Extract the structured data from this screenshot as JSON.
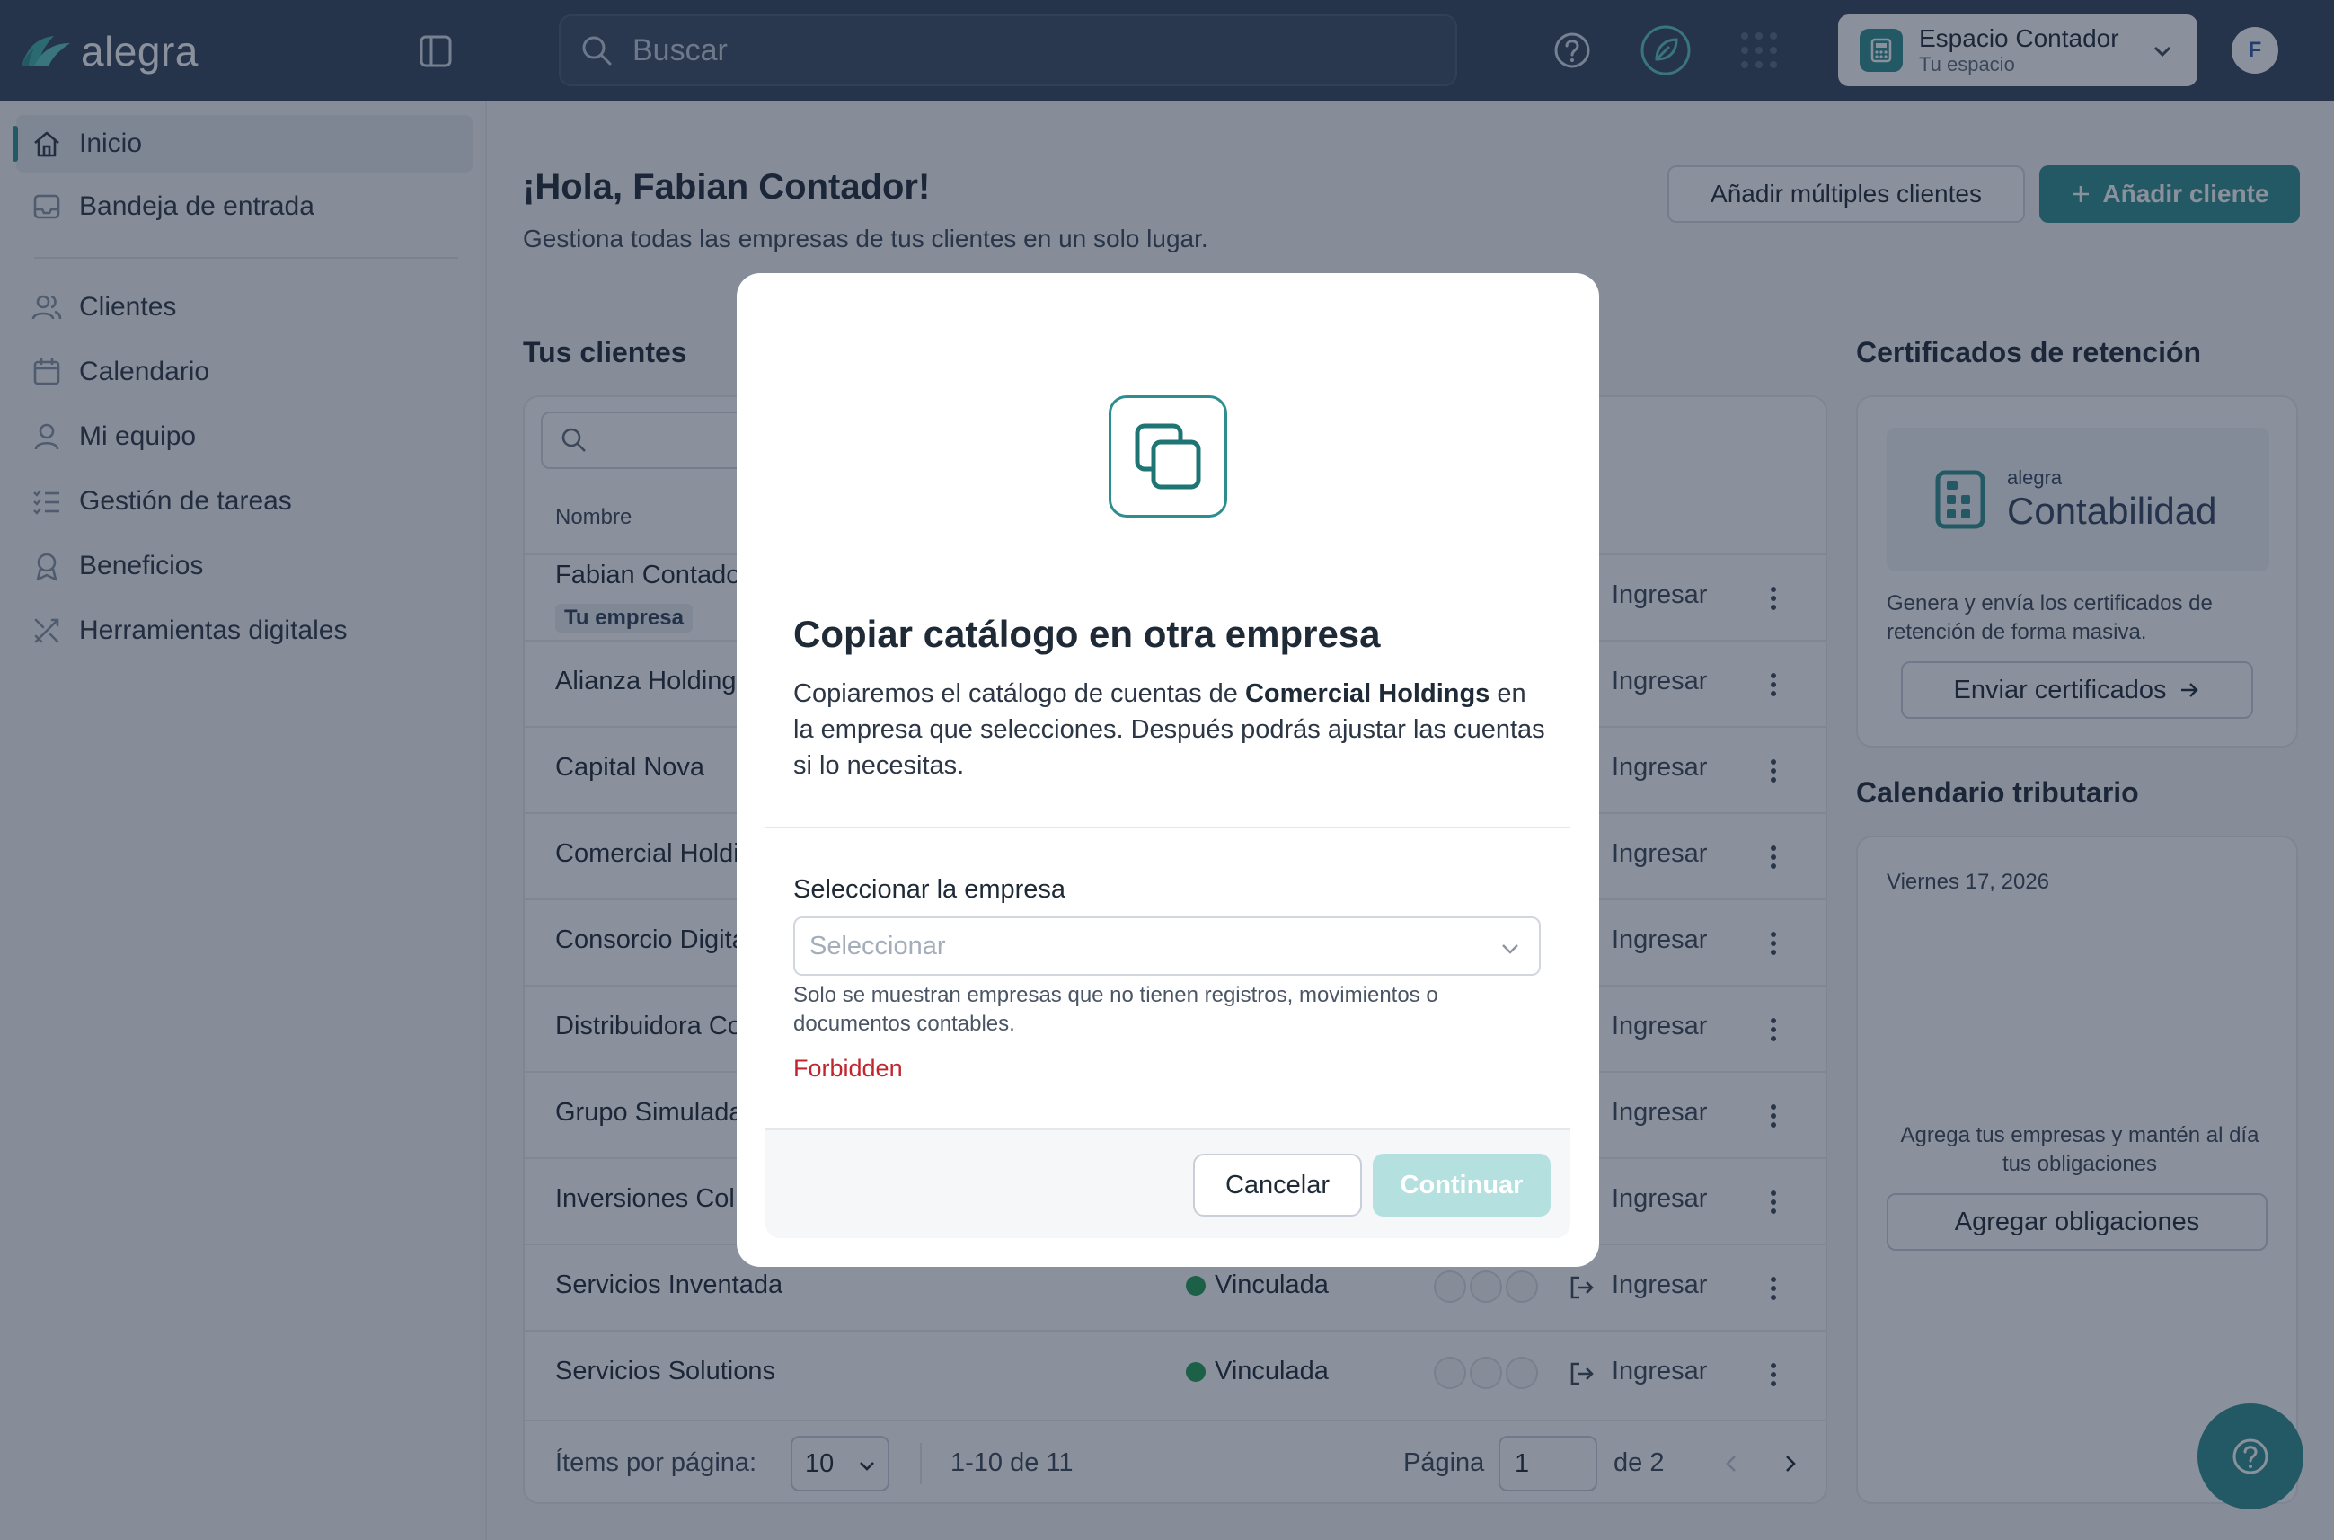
{
  "app": {
    "brand": "alegra",
    "accent": "#2e8e8e",
    "topbar_color": "#32435c"
  },
  "topbar": {
    "search_placeholder": "Buscar",
    "workspace": {
      "title": "Espacio Contador",
      "subtitle": "Tu espacio"
    },
    "avatar_initial": "F",
    "icons": [
      "panel-toggle-icon",
      "help-icon",
      "leaf-icon",
      "apps-grid-icon",
      "chevron-down-icon"
    ]
  },
  "sidebar": {
    "items": [
      {
        "label": "Inicio",
        "icon": "home-icon",
        "active": true
      },
      {
        "label": "Bandeja de entrada",
        "icon": "inbox-icon"
      },
      {
        "label": "Clientes",
        "icon": "users-icon"
      },
      {
        "label": "Calendario",
        "icon": "calendar-icon"
      },
      {
        "label": "Mi equipo",
        "icon": "user-icon"
      },
      {
        "label": "Gestión de tareas",
        "icon": "task-list-icon"
      },
      {
        "label": "Beneficios",
        "icon": "award-icon"
      },
      {
        "label": "Herramientas digitales",
        "icon": "tools-icon"
      }
    ]
  },
  "main": {
    "greeting": "¡Hola, Fabian Contador!",
    "subtitle": "Gestiona todas las empresas de tus clientes en un solo lugar.",
    "add_multiple_label": "Añadir múltiples clientes",
    "add_client_label": "Añadir cliente",
    "clients_title": "Tus clientes",
    "table": {
      "column_name": "Nombre",
      "enter_label": "Ingresar",
      "status_label": "Vinculada",
      "rows": [
        {
          "name": "Fabian Contador",
          "tag": "Tu empresa"
        },
        {
          "name": "Alianza Holdings"
        },
        {
          "name": "Capital Nova"
        },
        {
          "name": "Comercial Holdings"
        },
        {
          "name": "Consorcio Digital"
        },
        {
          "name": "Distribuidora Co"
        },
        {
          "name": "Grupo Simulada"
        },
        {
          "name": "Inversiones Col"
        },
        {
          "name": "Servicios Inventada"
        },
        {
          "name": "Servicios Solutions"
        }
      ],
      "visible_status_rows": [
        "Servicios Inventada",
        "Servicios Solutions"
      ]
    },
    "pagination": {
      "items_per_page_label": "Ítems por página:",
      "items_per_page": "10",
      "range": "1-10 de 11",
      "page_label": "Página",
      "page": "1",
      "of_total": "de 2"
    }
  },
  "right": {
    "certificates": {
      "title": "Certificados de retención",
      "promo_small": "alegra",
      "promo_big": "Contabilidad",
      "text": "Genera y envía los certificados de retención de forma masiva.",
      "button": "Enviar certificados"
    },
    "calendar": {
      "title": "Calendario tributario",
      "date": "Viernes 17, 2026",
      "text": "Agrega tus empresas y mantén al día tus obligaciones",
      "button": "Agregar obligaciones"
    }
  },
  "modal": {
    "title": "Copiar catálogo en otra empresa",
    "desc_before": "Copiaremos el catálogo de cuentas de ",
    "desc_company": "Comercial Holdings",
    "desc_after": " en la empresa que selecciones. Después podrás ajustar las cuentas si lo necesitas.",
    "field_label": "Seleccionar la empresa",
    "select_placeholder": "Seleccionar",
    "help": "Solo se muestran empresas que no tienen registros, movimientos o documentos contables.",
    "error": "Forbidden",
    "cancel": "Cancelar",
    "continue": "Continuar",
    "icon": "copy-icon"
  }
}
